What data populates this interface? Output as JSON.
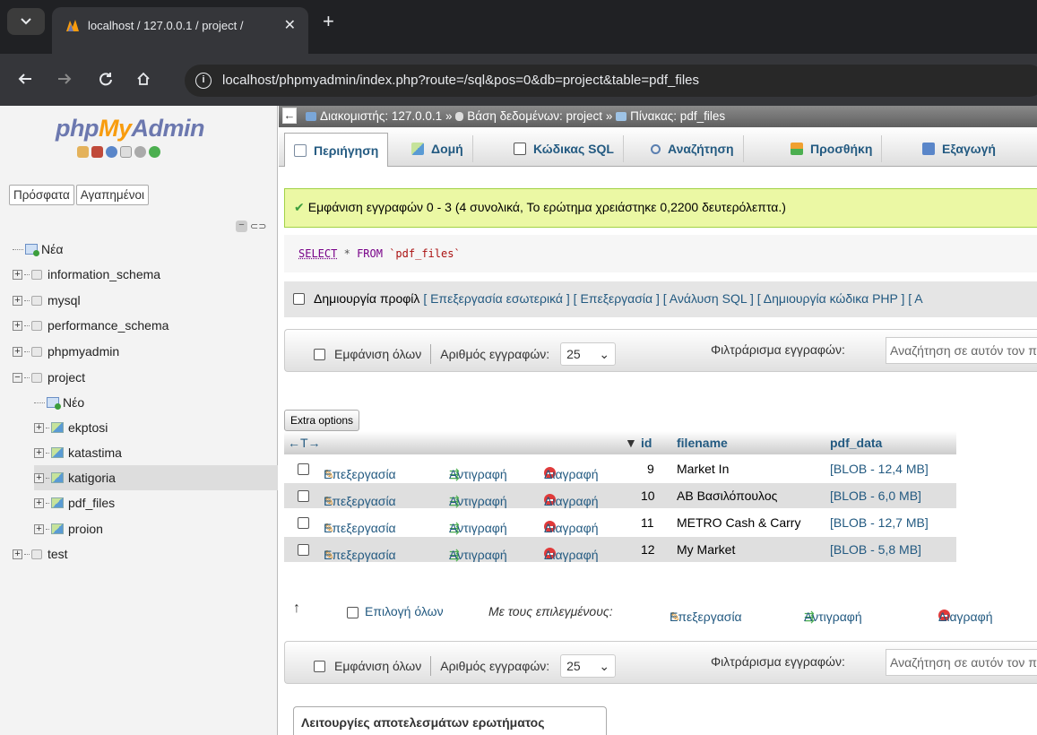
{
  "browser": {
    "tab_title": "localhost / 127.0.0.1 / project /",
    "tab_close": "✕",
    "new_tab": "+",
    "url": "localhost/phpmyadmin/index.php?route=/sql&pos=0&db=project&table=pdf_files"
  },
  "sidebar": {
    "logo_php": "php",
    "logo_my": "My",
    "logo_admin": "Admin",
    "tab_recent": "Πρόσφατα",
    "tab_favorites": "Αγαπημένοι",
    "tree": {
      "new": "Νέα",
      "db1": "information_schema",
      "db2": "mysql",
      "db3": "performance_schema",
      "db4": "phpmyadmin",
      "db5": "project",
      "project_new": "Νέο",
      "t1": "ekptosi",
      "t2": "katastima",
      "t3": "katigoria",
      "t4": "pdf_files",
      "t5": "proion",
      "db6": "test"
    }
  },
  "breadcrumb": {
    "server": "Διακομιστής: 127.0.0.1",
    "database": "Βάση δεδομένων: project",
    "table": "Πίνακας: pdf_files",
    "sep": "»"
  },
  "tabs": {
    "browse": "Περιήγηση",
    "structure": "Δομή",
    "sql": "Κώδικας SQL",
    "search": "Αναζήτηση",
    "insert": "Προσθήκη",
    "export": "Εξαγωγή"
  },
  "message": "Εμφάνιση εγγραφών 0 - 3 (4 συνολικά, Το ερώτημα χρειάστηκε 0,2200 δευτερόλεπτα.)",
  "query": {
    "select": "SELECT",
    "star": "*",
    "from": "FROM",
    "table": "`pdf_files`"
  },
  "profile": {
    "label": "Δημιουργία προφίλ",
    "links": "[ Επεξεργασία εσωτερικά ] [ Επεξεργασία ] [ Ανάλυση SQL ] [ Δημιουργία κώδικα PHP ] [ Α"
  },
  "nav": {
    "show_all": "Εμφάνιση όλων",
    "row_count_label": "Αριθμός εγγραφών:",
    "row_count": "25",
    "filter_label": "Φιλτράρισμα εγγραφών:",
    "filter_placeholder": "Αναζήτηση σε αυτόν τον πίνακα"
  },
  "extra_options": "Extra options",
  "table": {
    "arrows": "←T→",
    "columns": [
      "id",
      "filename",
      "pdf_data"
    ],
    "sort_arrow": "▼",
    "edit": "Επεξεργασία",
    "copy": "Αντιγραφή",
    "delete": "Διαγραφή",
    "rows": [
      {
        "id": "9",
        "filename": "Market In",
        "pdf_data": "[BLOB - 12,4 MB]"
      },
      {
        "id": "10",
        "filename": "AB Βασιλόπουλος",
        "pdf_data": "[BLOB - 6,0 MB]"
      },
      {
        "id": "11",
        "filename": "METRO Cash & Carry",
        "pdf_data": "[BLOB - 12,7 MB]"
      },
      {
        "id": "12",
        "filename": "My Market",
        "pdf_data": "[BLOB - 5,8 MB]"
      }
    ]
  },
  "bulk": {
    "select_all": "Επιλογή όλων",
    "with_selected": "Με τους επιλεγμένους:",
    "edit": "Επεξεργασία",
    "copy": "Αντιγραφή",
    "delete": "Διαγραφή"
  },
  "ops_title": "Λειτουργίες αποτελεσμάτων ερωτήματος",
  "colors": {
    "link": "#235a81",
    "success_bg": "#ebf8a4",
    "logo_blue": "#6c78af",
    "logo_orange": "#f89c0e",
    "chrome_dark": "#202124"
  }
}
